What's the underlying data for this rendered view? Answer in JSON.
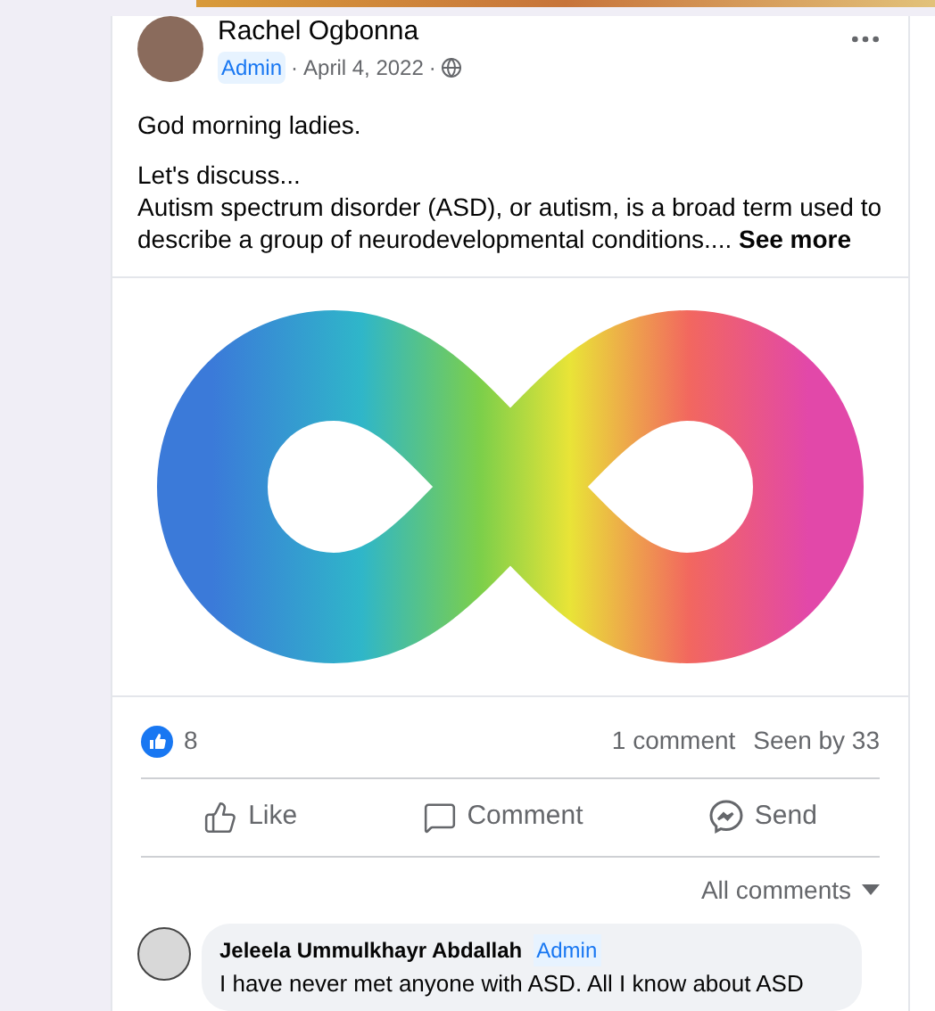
{
  "post": {
    "author": "Rachel Ogbonna",
    "badge": "Admin",
    "separator": "·",
    "date": "April 4, 2022",
    "greeting": "God morning ladies.",
    "intro": "Let's discuss...",
    "body": "Autism spectrum disorder (ASD), or autism, is a broad term used to describe a group of neurodevelopmental conditions....",
    "see_more": "See more"
  },
  "stats": {
    "likes": "8",
    "comments": "1 comment",
    "seen": "Seen by 33"
  },
  "actions": [
    {
      "kind": "like",
      "label": "Like"
    },
    {
      "kind": "comment",
      "label": "Comment"
    },
    {
      "kind": "send",
      "label": "Send"
    }
  ],
  "comments_filter": "All comments",
  "comment": {
    "author": "Jeleela Ummulkhayr Abdallah",
    "badge": "Admin",
    "text": "I have never met anyone with ASD. All I know about ASD"
  }
}
